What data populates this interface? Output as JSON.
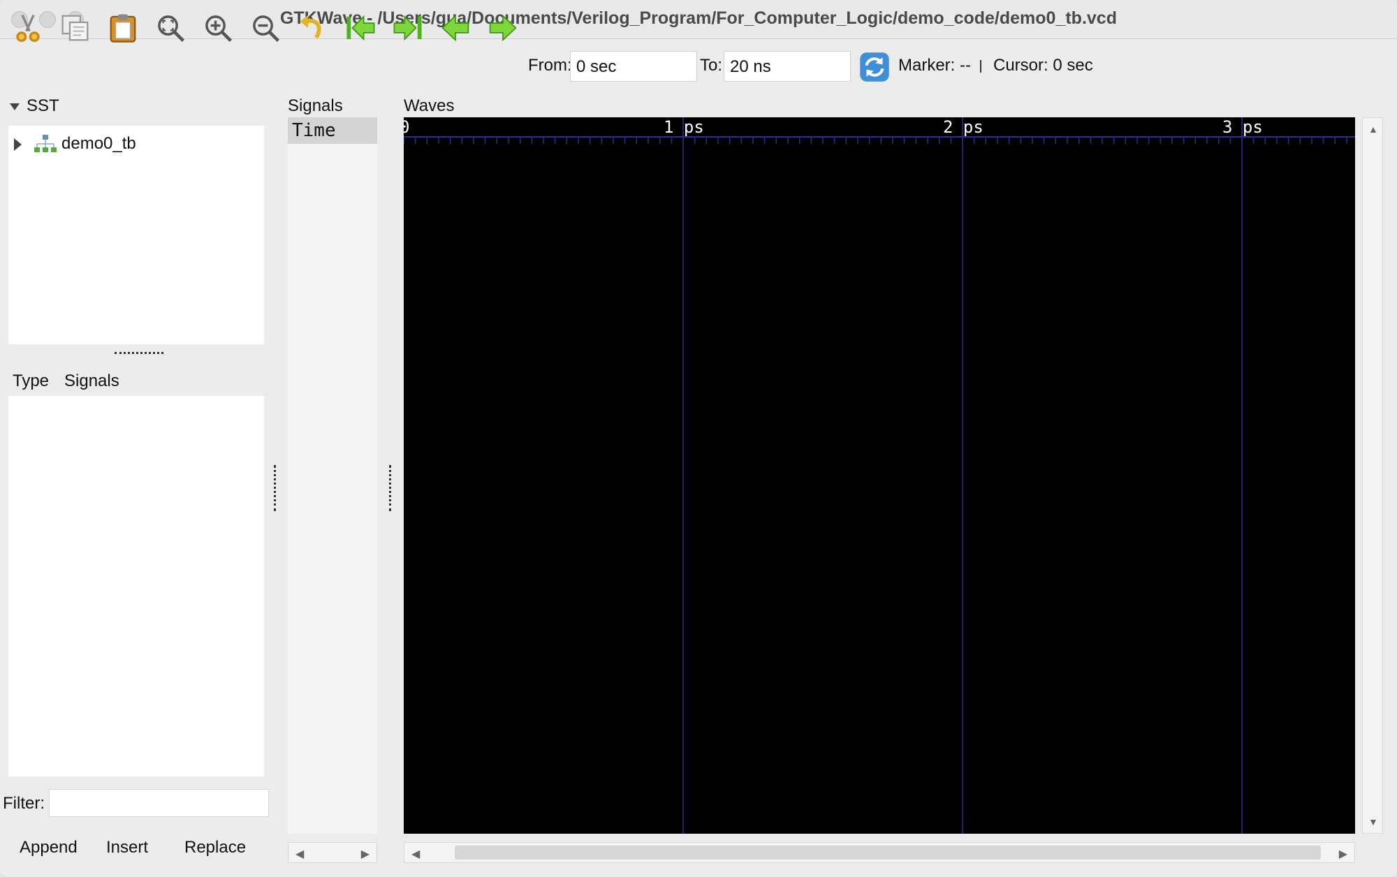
{
  "window": {
    "title": "GTKWave - /Users/gua/Documents/Verilog_Program/For_Computer_Logic/demo_code/demo0_tb.vcd"
  },
  "toolbar": {
    "from_label": "From:",
    "from_value": "0 sec",
    "to_label": "To:",
    "to_value": "20 ns",
    "marker_text": "Marker: --",
    "cursor_text": "Cursor: 0 sec",
    "icons": [
      "cut-icon",
      "copy-icon",
      "paste-icon",
      "zoom-fit-icon",
      "zoom-in-icon",
      "zoom-out-icon",
      "undo-icon",
      "go-to-start-icon",
      "go-to-end-icon",
      "previous-icon",
      "next-icon",
      "reload-icon"
    ]
  },
  "sst": {
    "title": "SST",
    "tree": [
      {
        "label": "demo0_tb"
      }
    ],
    "type_header": "Type",
    "signals_header": "Signals",
    "filter_label": "Filter:",
    "filter_value": "",
    "buttons": {
      "append": "Append",
      "insert": "Insert",
      "replace": "Replace"
    }
  },
  "signals_pane": {
    "title": "Signals",
    "rows": [
      "Time"
    ]
  },
  "waves_pane": {
    "title": "Waves",
    "timeline": {
      "labels": [
        "0",
        "1 ps",
        "2 ps",
        "3 ps"
      ],
      "background": "#000000",
      "grid_color": "#2c2c8c",
      "label_color": "#ffffff"
    }
  }
}
